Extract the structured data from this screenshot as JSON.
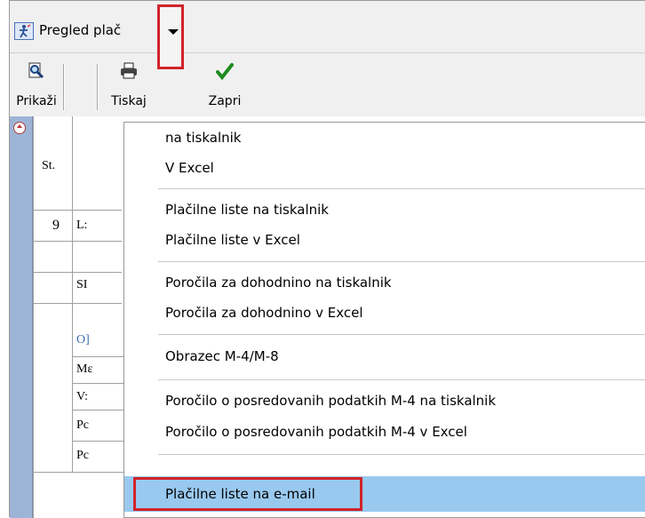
{
  "window": {
    "title": "Pregled plač"
  },
  "toolbar": {
    "show_label": "Prikaži",
    "print_label": "Tiskaj",
    "close_label": "Zapri"
  },
  "grid": {
    "header_st": "St.",
    "rows": [
      {
        "c1": "9",
        "c2": "L:"
      },
      {
        "c1": "",
        "c2": "SI"
      },
      {
        "c1": "",
        "c2": "O]"
      },
      {
        "c1": "",
        "c2": "Mε"
      },
      {
        "c1": "",
        "c2": "V:"
      },
      {
        "c1": "",
        "c2": "Pc"
      },
      {
        "c1": "",
        "c2": "Pc"
      }
    ]
  },
  "menu": {
    "items": [
      "na tiskalnik",
      "V Excel",
      "Plačilne liste na tiskalnik",
      "Plačilne liste v Excel",
      "Poročila za dohodnino na tiskalnik",
      "Poročila za dohodnino v Excel",
      "Obrazec M-4/M-8",
      "Poročilo o posredovanih podatkih M-4 na tiskalnik",
      "Poročilo o posredovanih podatkih M-4 v Excel",
      "Plačilne liste na e-mail"
    ],
    "highlighted_index": 9
  },
  "colors": {
    "highlight": "#99c9ef",
    "annotation_red": "#d1232a",
    "strip_blue": "#9eb4d6",
    "grid_blue_text": "#3a6db0"
  },
  "icons": {
    "app": "person-chart-icon",
    "show": "magnifier-doc-icon",
    "print": "printer-icon",
    "close": "checkmark-icon",
    "dropdown": "chevron-down-icon"
  }
}
